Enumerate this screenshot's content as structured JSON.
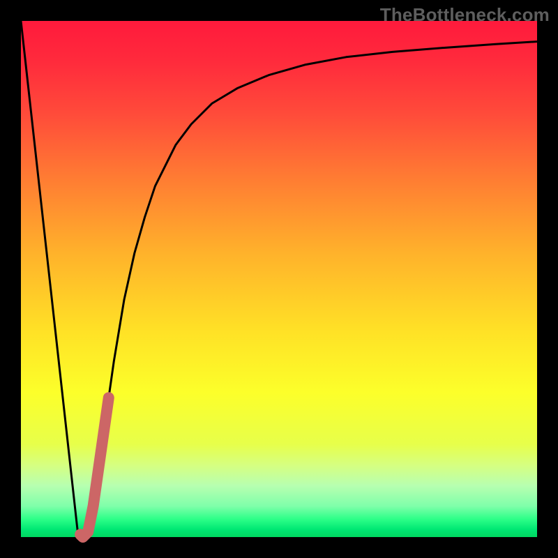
{
  "watermark": "TheBottleneck.com",
  "colors": {
    "frame": "#000000",
    "curve": "#000000",
    "highlight": "#cc6666",
    "gradient_stops": [
      {
        "offset": 0.0,
        "color": "#ff1a3c"
      },
      {
        "offset": 0.08,
        "color": "#ff2b3c"
      },
      {
        "offset": 0.18,
        "color": "#ff4b3a"
      },
      {
        "offset": 0.3,
        "color": "#ff7a33"
      },
      {
        "offset": 0.45,
        "color": "#ffb22b"
      },
      {
        "offset": 0.6,
        "color": "#ffe126"
      },
      {
        "offset": 0.72,
        "color": "#fcff2a"
      },
      {
        "offset": 0.82,
        "color": "#e7ff4a"
      },
      {
        "offset": 0.86,
        "color": "#d6ff80"
      },
      {
        "offset": 0.9,
        "color": "#b8ffb0"
      },
      {
        "offset": 0.94,
        "color": "#7fffaa"
      },
      {
        "offset": 0.965,
        "color": "#2dff88"
      },
      {
        "offset": 0.985,
        "color": "#00e874"
      },
      {
        "offset": 1.0,
        "color": "#00d861"
      }
    ]
  },
  "chart_data": {
    "type": "line",
    "title": "",
    "xlabel": "",
    "ylabel": "",
    "xlim": [
      0,
      100
    ],
    "ylim": [
      0,
      100
    ],
    "legend": false,
    "series": [
      {
        "name": "bottleneck-curve",
        "x": [
          0,
          4,
          8,
          10,
          11,
          12,
          13,
          14,
          15,
          16,
          17,
          18,
          19,
          20,
          22,
          24,
          26,
          28,
          30,
          33,
          37,
          42,
          48,
          55,
          63,
          72,
          82,
          92,
          100
        ],
        "y": [
          100,
          64,
          28,
          10,
          1,
          0,
          1,
          6,
          13,
          20,
          27,
          34,
          40,
          46,
          55,
          62,
          68,
          72,
          76,
          80,
          84,
          87,
          89.5,
          91.5,
          93,
          94,
          94.8,
          95.5,
          96
        ]
      },
      {
        "name": "highlight-segment",
        "x": [
          11.5,
          12,
          13,
          14,
          15,
          16,
          17
        ],
        "y": [
          0.5,
          0,
          1,
          6,
          13,
          20,
          27
        ]
      }
    ],
    "annotations": []
  }
}
